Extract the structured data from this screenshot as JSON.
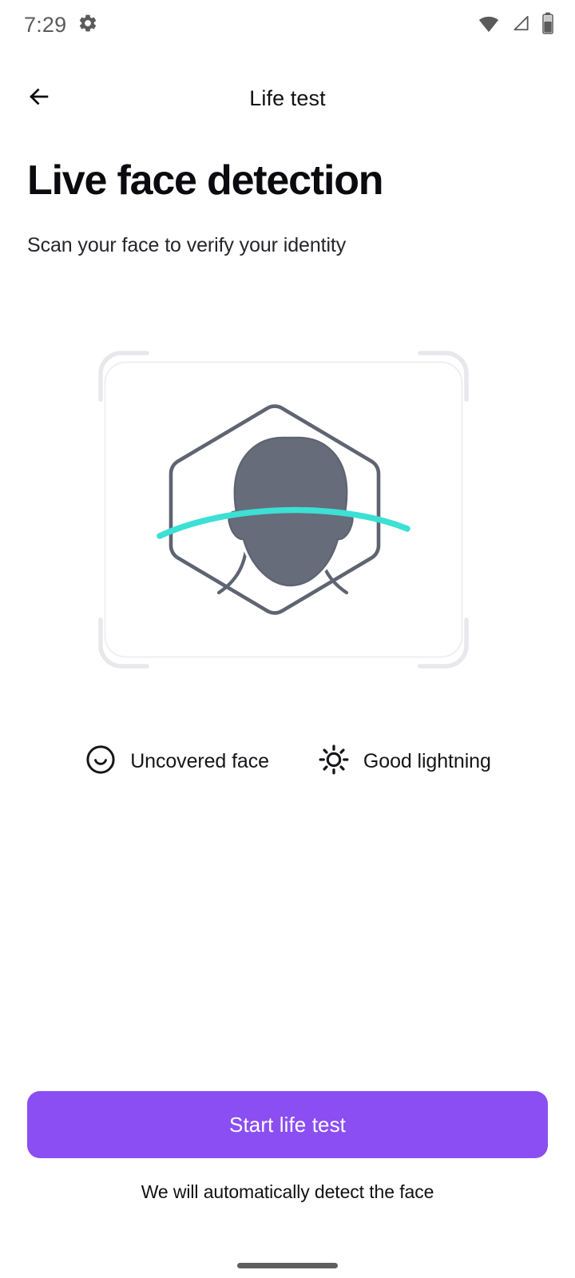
{
  "status_bar": {
    "time": "7:29",
    "icons": [
      "gear-icon",
      "wifi-icon",
      "signal-triangle-icon",
      "battery-icon"
    ],
    "battery_level_pct": 62
  },
  "app_bar": {
    "back_icon": "arrow-left-icon",
    "title": "Life test"
  },
  "header": {
    "title": "Live face detection",
    "subtitle": "Scan your face to verify your identity"
  },
  "illustration": {
    "name": "face-scan-illustration",
    "frame_icon": "scan-corner-brackets",
    "face_icon": "hexagon-face-outline",
    "scan_line_icon": "scan-arc"
  },
  "hints": [
    {
      "icon": "smiley-face-icon",
      "label": "Uncovered face"
    },
    {
      "icon": "sun-brightness-icon",
      "label": "Good lightning"
    }
  ],
  "cta": {
    "label": "Start life test",
    "footnote": "We will automatically detect the face"
  },
  "colors": {
    "accent_purple": "#8b4ef2",
    "scan_cyan": "#3ce0d4",
    "illustration_slate": "#5f6473",
    "head_fill": "#676c7a",
    "bracket_gray": "#e8e8ec",
    "card_border": "#efeff2",
    "status_gray": "#5b5b5b",
    "background": "#ffffff"
  }
}
